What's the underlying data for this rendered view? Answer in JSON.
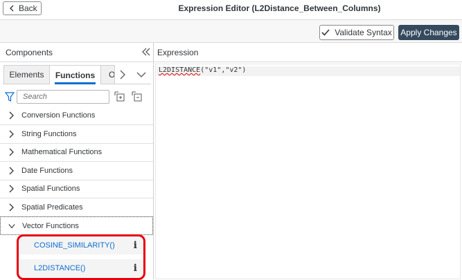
{
  "header": {
    "back_label": "Back",
    "title": "Expression Editor (L2Distance_Between_Columns)"
  },
  "toolbar": {
    "validate_label": "Validate Syntax",
    "apply_label": "Apply Changes",
    "apply_color": "#354a5f"
  },
  "components": {
    "title": "Components",
    "tabs": [
      {
        "label": "Elements"
      },
      {
        "label": "Functions"
      },
      {
        "label": "O"
      }
    ],
    "search_placeholder": "Search",
    "tree": [
      {
        "label": "Conversion Functions"
      },
      {
        "label": "String Functions"
      },
      {
        "label": "Mathematical Functions"
      },
      {
        "label": "Date Functions"
      },
      {
        "label": "Spatial Functions"
      },
      {
        "label": "Spatial Predicates"
      },
      {
        "label": "Vector Functions"
      }
    ],
    "vector_functions": [
      {
        "label": "COSINE_SIMILARITY()"
      },
      {
        "label": "L2DISTANCE()"
      }
    ],
    "highlight_color": "#e8000d"
  },
  "expression": {
    "title": "Expression",
    "fn_name": "L2DISTANCE",
    "args": "(\"v1\",\"v2\")"
  }
}
